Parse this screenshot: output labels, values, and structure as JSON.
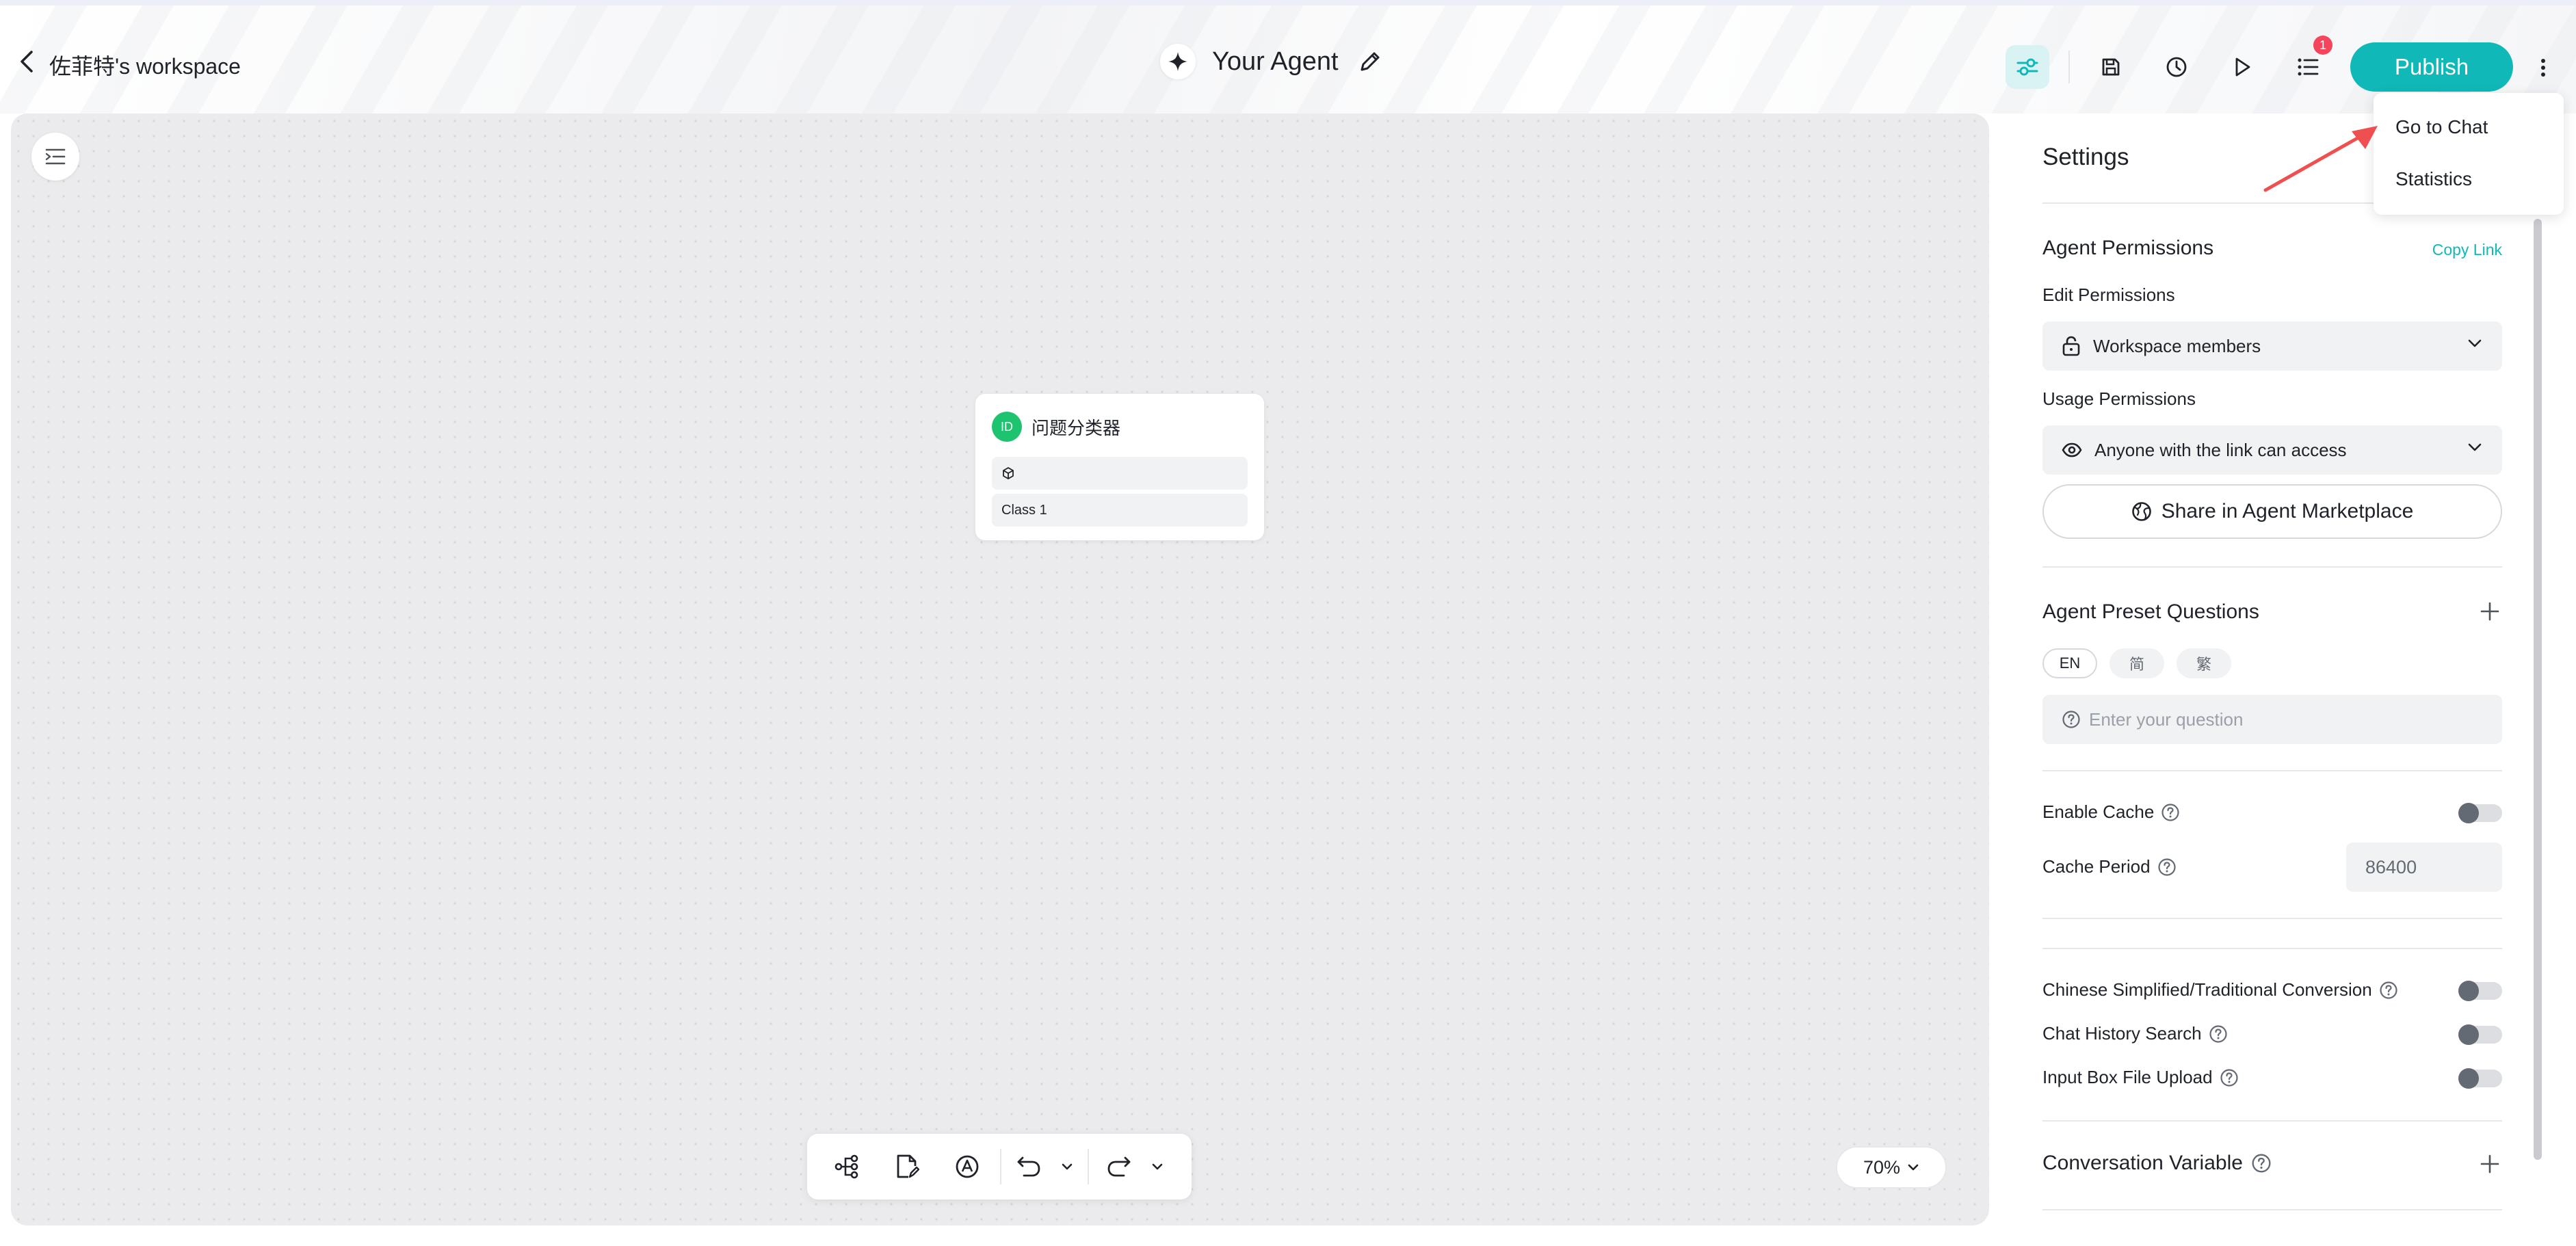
{
  "header": {
    "workspace_name": "佐菲特's workspace",
    "agent_title": "Your Agent",
    "publish_label": "Publish",
    "notification_count": "1",
    "accent_color": "#11b8b8"
  },
  "menu": {
    "items": [
      {
        "label": "Go to Chat"
      },
      {
        "label": "Statistics"
      }
    ]
  },
  "canvas": {
    "node": {
      "icon_text": "ID",
      "title": "问题分类器",
      "rows": [
        "",
        "Class 1"
      ]
    },
    "zoom_level": "70%"
  },
  "settings": {
    "title": "Settings",
    "agent_permissions": {
      "title": "Agent Permissions",
      "copy_link": "Copy Link",
      "edit_label": "Edit Permissions",
      "edit_value": "Workspace members",
      "usage_label": "Usage Permissions",
      "usage_value": "Anyone with the link can access",
      "share_label": "Share in Agent Marketplace"
    },
    "preset_questions": {
      "title": "Agent Preset Questions",
      "languages": [
        "EN",
        "简",
        "繁"
      ],
      "placeholder": "Enter your question"
    },
    "cache": {
      "enable_label": "Enable Cache",
      "enabled": false,
      "period_label": "Cache Period",
      "period_value": "86400"
    },
    "toggles": [
      {
        "label": "Chinese Simplified/Traditional Conversion",
        "enabled": false
      },
      {
        "label": "Chat History Search",
        "enabled": false
      },
      {
        "label": "Input Box File Upload",
        "enabled": false
      }
    ],
    "conversation_variable": {
      "title": "Conversation Variable"
    }
  }
}
